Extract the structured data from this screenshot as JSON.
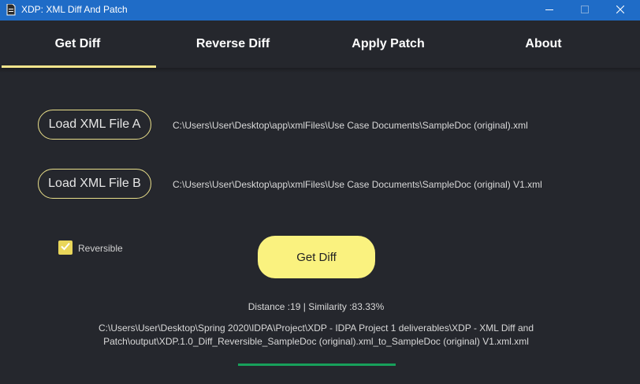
{
  "window": {
    "title": "XDP: XML Diff And Patch",
    "icon": "document-icon",
    "controls": {
      "minimize": "minimize-icon",
      "maximize": "maximize-icon",
      "close": "close-icon"
    }
  },
  "tabs": [
    {
      "label": "Get Diff",
      "active": true
    },
    {
      "label": "Reverse Diff",
      "active": false
    },
    {
      "label": "Apply Patch",
      "active": false
    },
    {
      "label": "About",
      "active": false
    }
  ],
  "file_a": {
    "button_label": "Load XML File A",
    "path": "C:\\Users\\User\\Desktop\\app\\xmlFiles\\Use Case Documents\\SampleDoc (original).xml"
  },
  "file_b": {
    "button_label": "Load XML File B",
    "path": "C:\\Users\\User\\Desktop\\app\\xmlFiles\\Use Case Documents\\SampleDoc (original) V1.xml"
  },
  "reversible": {
    "label": "Reversible",
    "checked": true
  },
  "get_diff_button": "Get Diff",
  "result": {
    "stats": "Distance :19 | Similarity :83.33%",
    "output_path": "C:\\Users\\User\\Desktop\\Spring 2020\\IDPA\\Project\\XDP - IDPA Project 1 deliverables\\XDP - XML Diff and Patch\\output\\XDP.1.0_Diff_Reversible_SampleDoc (original).xml_to_SampleDoc (original) V1.xml.xml"
  },
  "progress": {
    "fraction": 1.0
  },
  "colors": {
    "titlebar": "#1f6cc7",
    "background": "#25272d",
    "accent_yellow": "#faf27f",
    "tab_indicator": "#f4e58c",
    "progress": "#17a05b"
  }
}
